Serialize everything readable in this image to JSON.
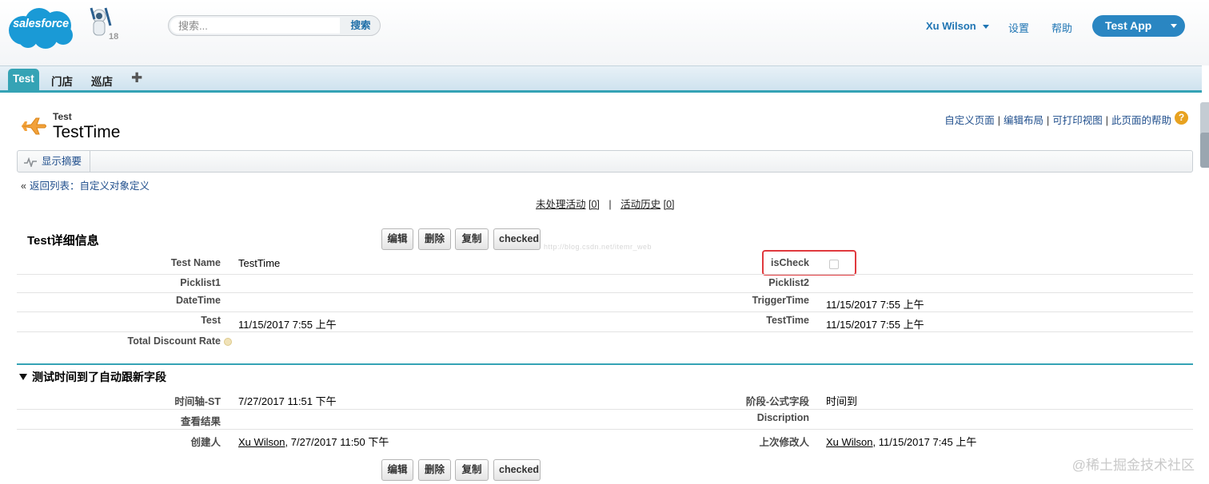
{
  "header": {
    "logo_text": "salesforce",
    "badge_count": "18",
    "search": {
      "placeholder": "搜索...",
      "button": "搜索"
    },
    "user_name": "Xu Wilson",
    "links": [
      "设置",
      "帮助"
    ],
    "app_button": "Test App"
  },
  "tabs": {
    "active": "Test",
    "items": [
      "门店",
      "巡店"
    ],
    "add": "✚"
  },
  "page": {
    "record_type": "Test",
    "record_name": "TestTime",
    "top_links": [
      "自定义页面",
      "编辑布局",
      "可打印视图",
      "此页面的帮助"
    ],
    "summary_button": "显示摘要",
    "back_link": "返回列表：自定义对象定义",
    "activity": {
      "open": "未处理活动",
      "open_count": "[0]",
      "sep": "|",
      "history": "活动历史",
      "history_count": "[0]"
    }
  },
  "detail": {
    "title": "Test详细信息",
    "buttons": [
      "编辑",
      "删除",
      "复制",
      "checked"
    ],
    "fields": {
      "test_name_label": "Test Name",
      "test_name_value": "TestTime",
      "is_check_label": "isCheck",
      "picklist1_label": "Picklist1",
      "picklist2_label": "Picklist2",
      "datetime_label": "DateTime",
      "trigger_time_label": "TriggerTime",
      "trigger_time_value": "11/15/2017 7:55 上午",
      "test_label": "Test",
      "test_value": "11/15/2017 7:55 上午",
      "testtime_label": "TestTime",
      "testtime_value": "11/15/2017 7:55 上午",
      "discount_label": "Total Discount Rate"
    }
  },
  "section2": {
    "title": "测试时间到了自动跟新字段",
    "timeline_label": "时间轴-ST",
    "timeline_value": "7/27/2017 11:51 下午",
    "stage_label": "阶段-公式字段",
    "stage_value": "时间到",
    "result_label": "查看结果",
    "discription_label": "Discription",
    "created_label": "创建人",
    "created_user": "Xu Wilson",
    "created_time": ", 7/27/2017 11:50 下午",
    "modified_label": "上次修改人",
    "modified_user": "Xu Wilson",
    "modified_time": ", 11/15/2017 7:45 上午"
  },
  "watermark": "http://blog.csdn.net/itemr_web",
  "site_mark": "@稀土掘金技术社区",
  "colors": {
    "accent": "#35a3b5",
    "brand": "#2a86c2",
    "highlight": "#e0393e"
  }
}
